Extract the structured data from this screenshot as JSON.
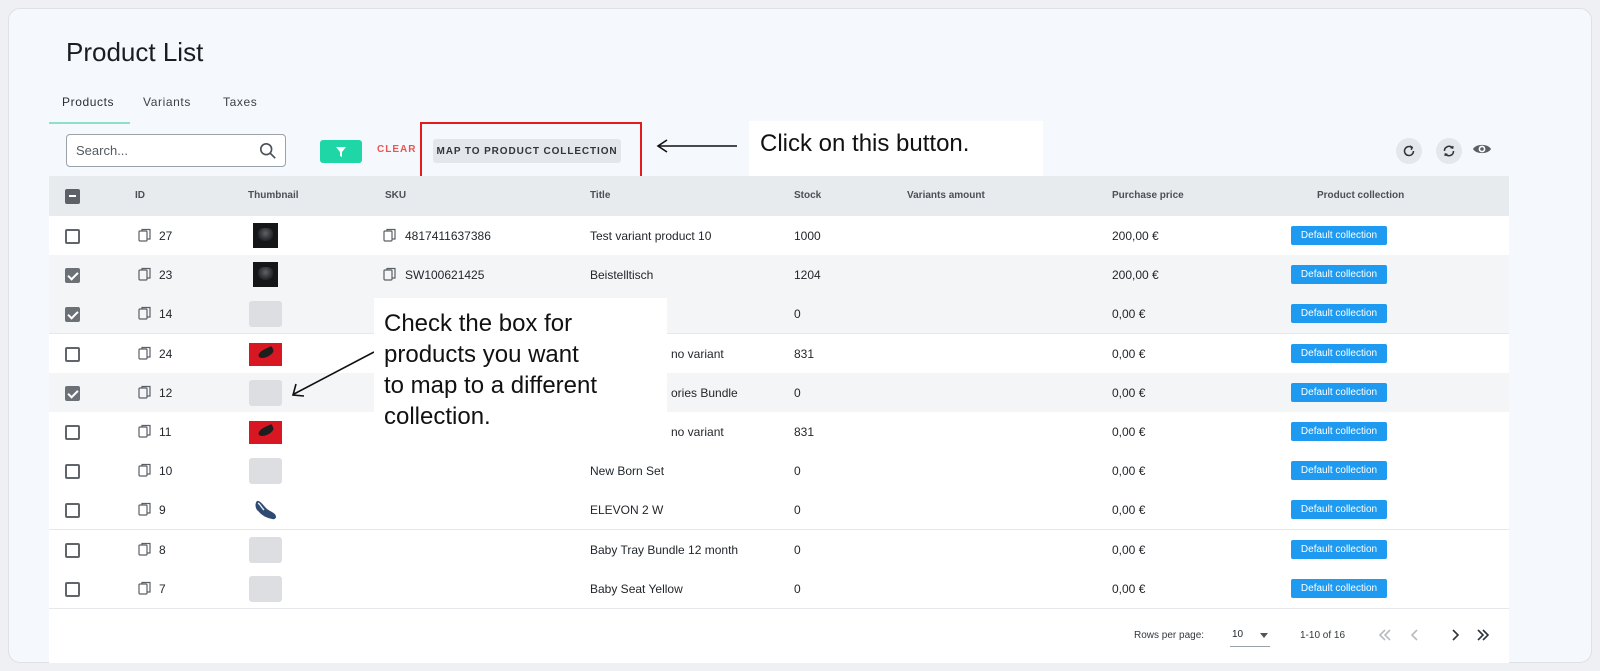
{
  "page": {
    "title": "Product List"
  },
  "tabs": [
    {
      "label": "Products",
      "active": true
    },
    {
      "label": "Variants",
      "active": false
    },
    {
      "label": "Taxes",
      "active": false
    }
  ],
  "toolbar": {
    "search_placeholder": "Search...",
    "clear_label": "CLEAR",
    "map_button_label": "MAP TO PRODUCT COLLECTION",
    "accent_color": "#1fd6a6"
  },
  "annotations": {
    "button_hint": "Click on this button.",
    "checkbox_hint": "Check the box for\nproducts you want\nto map to a different\ncollection."
  },
  "table": {
    "columns": [
      "ID",
      "Thumbnail",
      "SKU",
      "Title",
      "Stock",
      "Variants amount",
      "Purchase price",
      "Product collection"
    ],
    "rows": [
      {
        "checked": false,
        "id": "27",
        "thumbnail": "dark",
        "sku": "4817411637386",
        "title": "Test variant product 10",
        "stock": "1000",
        "variants_amount": "",
        "price": "200,00 €",
        "collection": "Default collection"
      },
      {
        "checked": true,
        "id": "23",
        "thumbnail": "dark",
        "sku": "SW100621425",
        "title": "Beistelltisch",
        "stock": "1204",
        "variants_amount": "",
        "price": "200,00 €",
        "collection": "Default collection"
      },
      {
        "checked": true,
        "id": "14",
        "thumbnail": "blank",
        "sku": "",
        "title": "",
        "stock": "0",
        "variants_amount": "",
        "price": "0,00 €",
        "collection": "Default collection"
      },
      {
        "checked": false,
        "id": "24",
        "thumbnail": "red",
        "sku": "",
        "title": "no variant",
        "stock": "831",
        "variants_amount": "",
        "price": "0,00 €",
        "collection": "Default collection"
      },
      {
        "checked": true,
        "id": "12",
        "thumbnail": "blank",
        "sku": "",
        "title": "ories Bundle",
        "stock": "0",
        "variants_amount": "",
        "price": "0,00 €",
        "collection": "Default collection"
      },
      {
        "checked": false,
        "id": "11",
        "thumbnail": "red",
        "sku": "",
        "title": "no variant",
        "stock": "831",
        "variants_amount": "",
        "price": "0,00 €",
        "collection": "Default collection"
      },
      {
        "checked": false,
        "id": "10",
        "thumbnail": "blank",
        "sku": "",
        "title": "New Born Set",
        "stock": "0",
        "variants_amount": "",
        "price": "0,00 €",
        "collection": "Default collection"
      },
      {
        "checked": false,
        "id": "9",
        "thumbnail": "shoe",
        "sku": "",
        "title": "ELEVON 2 W",
        "stock": "0",
        "variants_amount": "",
        "price": "0,00 €",
        "collection": "Default collection"
      },
      {
        "checked": false,
        "id": "8",
        "thumbnail": "blank",
        "sku": "",
        "title": "Baby Tray Bundle 12 month",
        "stock": "0",
        "variants_amount": "",
        "price": "0,00 €",
        "collection": "Default collection"
      },
      {
        "checked": false,
        "id": "7",
        "thumbnail": "blank",
        "sku": "",
        "title": "Baby Seat Yellow",
        "stock": "0",
        "variants_amount": "",
        "price": "0,00 €",
        "collection": "Default collection"
      }
    ]
  },
  "pagination": {
    "rows_per_page_label": "Rows per page:",
    "rows_per_page_value": "10",
    "range_label": "1-10 of 16"
  },
  "colors": {
    "badge": "#1e9bf0",
    "highlight": "#e11d1d",
    "clear": "#ef5350"
  }
}
